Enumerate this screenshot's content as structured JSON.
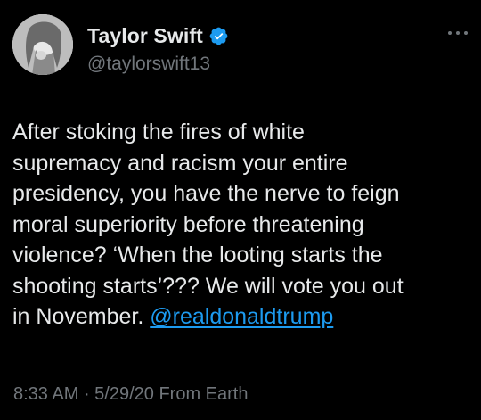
{
  "tweet": {
    "author": {
      "display_name": "Taylor Swift",
      "handle": "@taylorswift13",
      "verified": true
    },
    "body": {
      "lines": [
        "After stoking the fires of white",
        "supremacy and racism your entire",
        "presidency, you have the nerve to feign",
        "moral superiority before threatening",
        "violence? ‘When the looting starts the",
        "shooting starts’??? We will vote you out",
        "in November. "
      ],
      "mention": "@realdonaldtrump"
    },
    "meta": {
      "time": "8:33 AM",
      "separator": " · ",
      "date": "5/29/20",
      "source": " From Earth"
    }
  },
  "colors": {
    "background": "#000000",
    "text_primary": "#e7e9ea",
    "text_secondary": "#71767b",
    "link": "#1d9bf0",
    "verified_badge": "#1d9bf0"
  },
  "icons": {
    "verified": "verified-badge-icon",
    "more": "more-options-icon"
  }
}
